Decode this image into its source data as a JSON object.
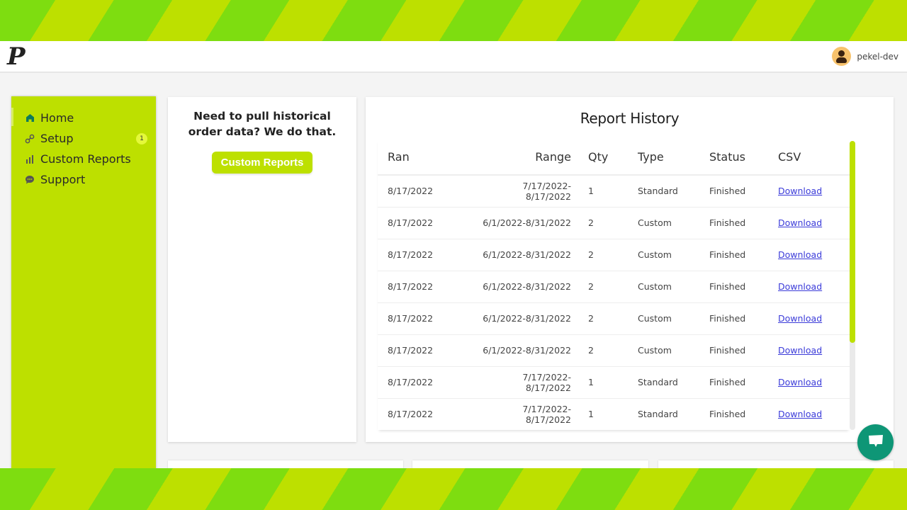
{
  "header": {
    "logo": "P",
    "username": "pekel-dev"
  },
  "sidebar": {
    "items": [
      {
        "label": "Home",
        "icon": "home-icon",
        "active": true
      },
      {
        "label": "Setup",
        "icon": "link-icon",
        "badge": "1"
      },
      {
        "label": "Custom Reports",
        "icon": "bar-chart-icon"
      },
      {
        "label": "Support",
        "icon": "chat-bubble-icon"
      }
    ]
  },
  "promo": {
    "text": "Need to pull historical order data? We do that.",
    "button_label": "Custom Reports"
  },
  "report_history": {
    "title": "Report History",
    "columns": [
      "Ran",
      "Range",
      "Qty",
      "Type",
      "Status",
      "CSV"
    ],
    "rows": [
      {
        "ran": "8/17/2022",
        "range": "7/17/2022-8/17/2022",
        "qty": "1",
        "type": "Standard",
        "status": "Finished",
        "csv": "Download"
      },
      {
        "ran": "8/17/2022",
        "range": "6/1/2022-8/31/2022",
        "qty": "2",
        "type": "Custom",
        "status": "Finished",
        "csv": "Download"
      },
      {
        "ran": "8/17/2022",
        "range": "6/1/2022-8/31/2022",
        "qty": "2",
        "type": "Custom",
        "status": "Finished",
        "csv": "Download"
      },
      {
        "ran": "8/17/2022",
        "range": "6/1/2022-8/31/2022",
        "qty": "2",
        "type": "Custom",
        "status": "Finished",
        "csv": "Download"
      },
      {
        "ran": "8/17/2022",
        "range": "6/1/2022-8/31/2022",
        "qty": "2",
        "type": "Custom",
        "status": "Finished",
        "csv": "Download"
      },
      {
        "ran": "8/17/2022",
        "range": "6/1/2022-8/31/2022",
        "qty": "2",
        "type": "Custom",
        "status": "Finished",
        "csv": "Download"
      },
      {
        "ran": "8/17/2022",
        "range": "7/17/2022-8/17/2022",
        "qty": "1",
        "type": "Standard",
        "status": "Finished",
        "csv": "Download"
      },
      {
        "ran": "8/17/2022",
        "range": "7/17/2022-8/17/2022",
        "qty": "1",
        "type": "Standard",
        "status": "Finished",
        "csv": "Download"
      }
    ]
  },
  "colors": {
    "brand_lime": "#bde000",
    "brand_green": "#7edd10",
    "chat_teal": "#0e9676",
    "link_blue": "#3b3bd9"
  }
}
